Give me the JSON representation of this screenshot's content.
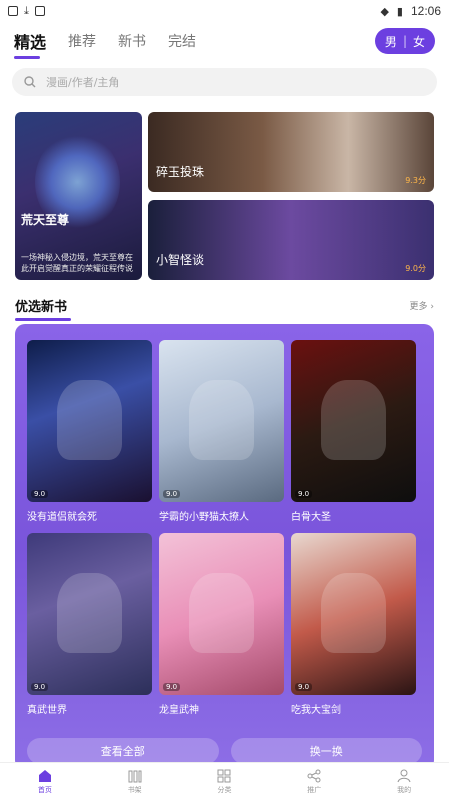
{
  "status": {
    "time": "12:06",
    "left_icons": [
      "usb-debug-icon",
      "download-icon",
      "notification-icon"
    ],
    "right_icons": [
      "wifi-icon",
      "battery-icon"
    ]
  },
  "tabs": [
    {
      "label": "精选",
      "active": true
    },
    {
      "label": "推荐",
      "active": false
    },
    {
      "label": "新书",
      "active": false
    },
    {
      "label": "完结",
      "active": false
    }
  ],
  "gender": {
    "male": "男",
    "sep": "|",
    "female": "女"
  },
  "search": {
    "placeholder": "漫画/作者/主角"
  },
  "banners": {
    "big": {
      "title": "荒天至尊",
      "desc": "一场神秘入侵边境，荒天至尊在此开启觉醒真正的荣耀征程传说"
    },
    "small": [
      {
        "title": "碎玉投珠",
        "score": "9.3分"
      },
      {
        "title": "小智怪谈",
        "score": "9.0分"
      }
    ]
  },
  "section": {
    "title": "优选新书",
    "more": "更多 ›"
  },
  "books": [
    {
      "name": "没有道侣就会死",
      "badge": "9.0"
    },
    {
      "name": "学霸的小野猫太撩人",
      "badge": "9.0"
    },
    {
      "name": "白骨大圣",
      "badge": "9.0"
    },
    {
      "name": "真武世界",
      "badge": "9.0"
    },
    {
      "name": "龙皇武神",
      "badge": "9.0"
    },
    {
      "name": "吃我大宝剑",
      "badge": "9.0"
    }
  ],
  "panel_buttons": {
    "left": "查看全部",
    "right": "换一换"
  },
  "bottom_nav": [
    {
      "label": "首页",
      "icon": "home-icon",
      "active": true
    },
    {
      "label": "书架",
      "icon": "bookshelf-icon",
      "active": false
    },
    {
      "label": "分类",
      "icon": "category-icon",
      "active": false
    },
    {
      "label": "推广",
      "icon": "share-icon",
      "active": false
    },
    {
      "label": "我的",
      "icon": "profile-icon",
      "active": false
    }
  ],
  "colors": {
    "accent": "#6c3fe0",
    "panel": "#7a55db",
    "score": "#ffb74a"
  }
}
